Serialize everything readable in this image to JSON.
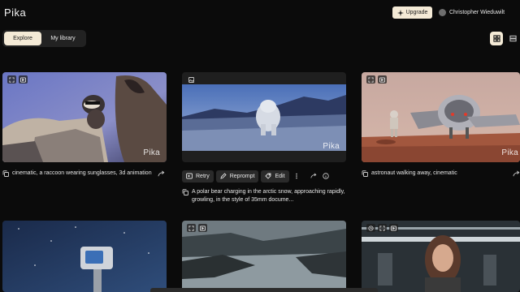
{
  "header": {
    "logo": "Pika",
    "upgrade_label": "Upgrade",
    "user_name": "Christopher Wieduwilt"
  },
  "tabs": {
    "explore": "Explore",
    "library": "My library"
  },
  "cards": [
    {
      "caption": "cinematic, a raccoon wearing sunglasses, 3d animation",
      "watermark": "Pika"
    },
    {
      "caption": "A polar bear charging in the arctic snow, approaching rapidly, growling, in the style of 35mm docume...",
      "watermark": "Pika"
    },
    {
      "caption": "astronaut walking away, cinematic",
      "watermark": "Pika"
    }
  ],
  "actions": {
    "retry": "Retry",
    "reprompt": "Reprompt",
    "edit": "Edit"
  },
  "colors": {
    "background": "#0b0b0b",
    "accent": "#f4ead6",
    "button_bg": "#2a2a2a"
  }
}
